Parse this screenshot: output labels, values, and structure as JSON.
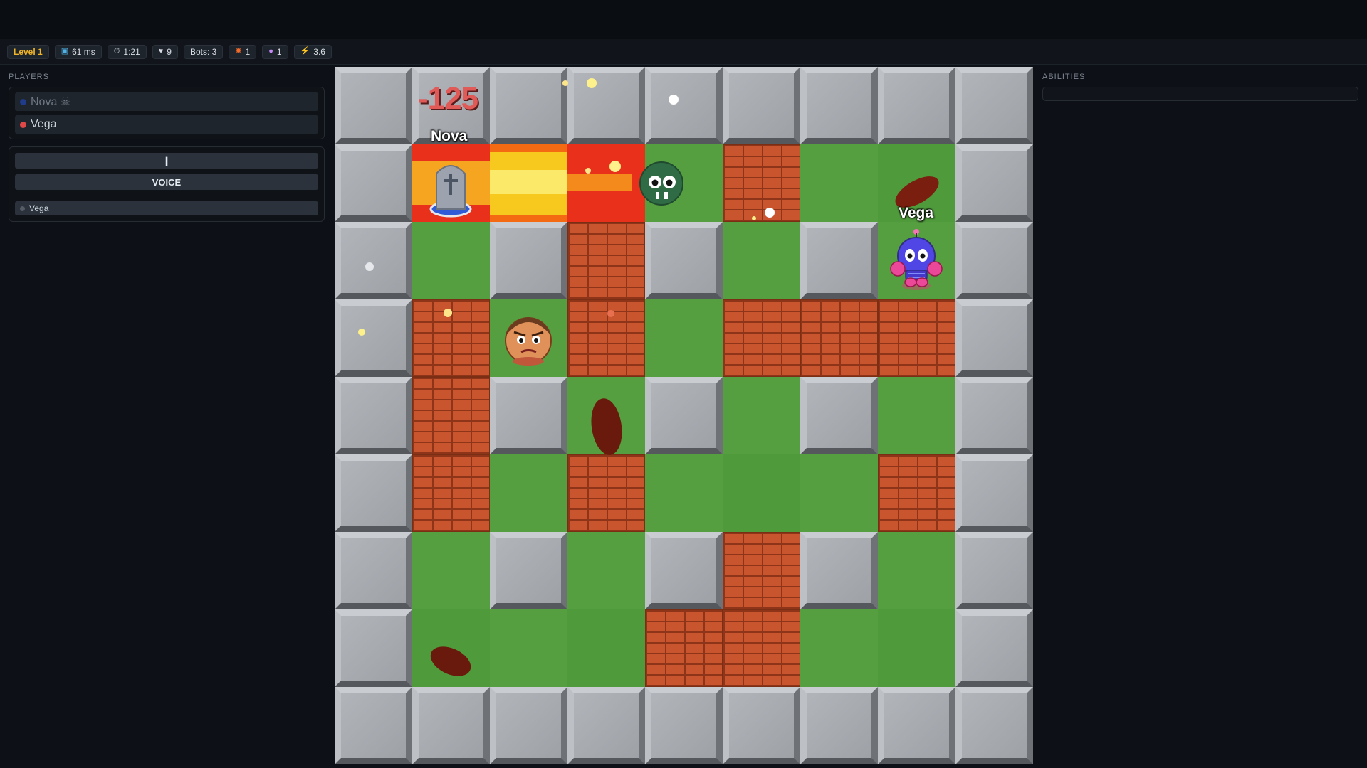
{
  "hud": {
    "level": "Level 1",
    "ping": "61 ms",
    "timer": "1:21",
    "lives": "9",
    "bots": "Bots: 3",
    "fire": "1",
    "bombs": "1",
    "speed": "3.6",
    "icons": [
      "ping-icon",
      "timer-icon",
      "heart-icon",
      "fire-icon",
      "bomb-icon",
      "bolt-icon"
    ]
  },
  "players_panel": {
    "title": "PLAYERS",
    "players": [
      {
        "name": "Nova ☠",
        "color": "#1f3b8a",
        "status": "dead"
      },
      {
        "name": "Vega",
        "color": "#e04848",
        "status": "alive"
      }
    ]
  },
  "voice_panel": {
    "mic_glyph": "❙",
    "voice_label": "VOICE",
    "member": "Vega"
  },
  "abilities_panel": {
    "title": "ABILITIES"
  },
  "game": {
    "score_popup": "-125",
    "name_nova": "Nova",
    "name_vega": "Vega",
    "grid_legend": {
      "W": "steel-wall",
      "B": "brick",
      "G": "grass"
    },
    "grid": [
      "WWWWWWWWW",
      "WGGGGBGGW",
      "WGWBWGWGW",
      "WBGBGBBBW",
      "WBWGWGWGW",
      "WBGBGGGBW",
      "WGWGWBWGW",
      "WGGGBBGGW",
      "WWWWWWWWW"
    ],
    "colors": {
      "grass": "#4f9b3c",
      "brick": "#c9552f",
      "wall": "#a7abb0",
      "fire": "#f08a1a",
      "score": "#e05a58"
    }
  }
}
